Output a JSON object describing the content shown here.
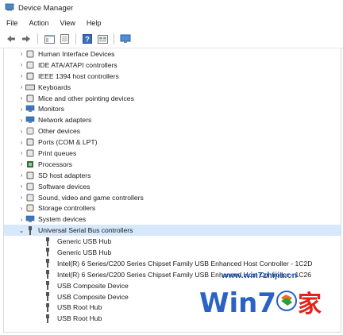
{
  "window": {
    "title": "Device Manager"
  },
  "menu": [
    "File",
    "Action",
    "View",
    "Help"
  ],
  "toolbar": [
    "back-icon",
    "forward-icon",
    "show-hide-tree-icon",
    "properties-icon",
    "help-icon",
    "view-icon",
    "monitor-scan-icon"
  ],
  "tree": {
    "categories": [
      {
        "label": "Human Interface Devices",
        "icon": "hid-icon"
      },
      {
        "label": "IDE ATA/ATAPI controllers",
        "icon": "ide-icon"
      },
      {
        "label": "IEEE 1394 host controllers",
        "icon": "firewire-icon"
      },
      {
        "label": "Keyboards",
        "icon": "keyboard-icon"
      },
      {
        "label": "Mice and other pointing devices",
        "icon": "mouse-icon"
      },
      {
        "label": "Monitors",
        "icon": "monitor-icon"
      },
      {
        "label": "Network adapters",
        "icon": "network-icon"
      },
      {
        "label": "Other devices",
        "icon": "other-devices-icon"
      },
      {
        "label": "Ports (COM & LPT)",
        "icon": "port-icon"
      },
      {
        "label": "Print queues",
        "icon": "printer-icon"
      },
      {
        "label": "Processors",
        "icon": "processor-icon"
      },
      {
        "label": "SD host adapters",
        "icon": "sd-icon"
      },
      {
        "label": "Software devices",
        "icon": "software-icon"
      },
      {
        "label": "Sound, video and game controllers",
        "icon": "sound-icon"
      },
      {
        "label": "Storage controllers",
        "icon": "storage-icon"
      },
      {
        "label": "System devices",
        "icon": "system-icon"
      }
    ],
    "expanded": {
      "label": "Universal Serial Bus controllers",
      "icon": "usb-icon",
      "children": [
        "Generic USB Hub",
        "Generic USB Hub",
        "Intel(R) 6 Series/C200 Series Chipset Family USB Enhanced Host Controller - 1C2D",
        "Intel(R) 6 Series/C200 Series Chipset Family USB Enhanced Host Controller - 1C26",
        "USB Composite Device",
        "USB Composite Device",
        "USB Root Hub",
        "USB Root Hub"
      ]
    }
  },
  "watermark": {
    "url": "www.win7zhijia.cn",
    "logo": "Win7家"
  },
  "colors": {
    "selection": "#d6e8fb",
    "accent": "#1b55b8",
    "watermark_red": "#e2231a"
  }
}
